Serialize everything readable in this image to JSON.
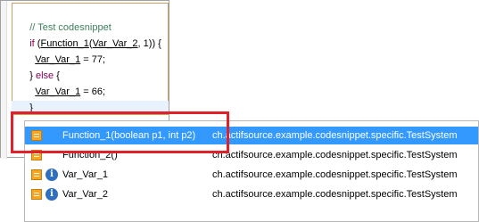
{
  "editor": {
    "lines": [
      {
        "kind": "comment",
        "text": "// Test codesnippet"
      },
      {
        "kind": "if",
        "kw": "if",
        "open": " (",
        "fn": "Function_1",
        "p1": "(",
        "arg": "Var_Var_2",
        "rest": ", 1)) {"
      },
      {
        "kind": "assign",
        "var": "Var_Var_1",
        "rest": " = 77;"
      },
      {
        "kind": "else",
        "close": "} ",
        "kw": "else",
        "rest": " {"
      },
      {
        "kind": "assign",
        "var": "Var_Var_1",
        "rest": " = 66;"
      },
      {
        "kind": "plain",
        "text": "}"
      }
    ]
  },
  "completion": {
    "items": [
      {
        "label": "Function_1(boolean p1, int p2)",
        "type": "ch.actifsource.example.codesnippet.specific.TestSystem",
        "icon": "method-icon",
        "selected": true
      },
      {
        "label": "Function_2()",
        "type": "ch.actifsource.example.codesnippet.specific.TestSystem",
        "icon": "method-icon",
        "selected": false
      },
      {
        "label": "Var_Var_1",
        "type": "ch.actifsource.example.codesnippet.specific.TestSystem",
        "icon": "info-icon",
        "selected": false
      },
      {
        "label": "Var_Var_2",
        "type": "ch.actifsource.example.codesnippet.specific.TestSystem",
        "icon": "info-icon",
        "selected": false
      }
    ],
    "info_glyph": "i"
  },
  "colors": {
    "selection": "#3399ff",
    "highlight_border": "#e0202a",
    "comment": "#3f7f5f",
    "keyword": "#7f0055"
  }
}
